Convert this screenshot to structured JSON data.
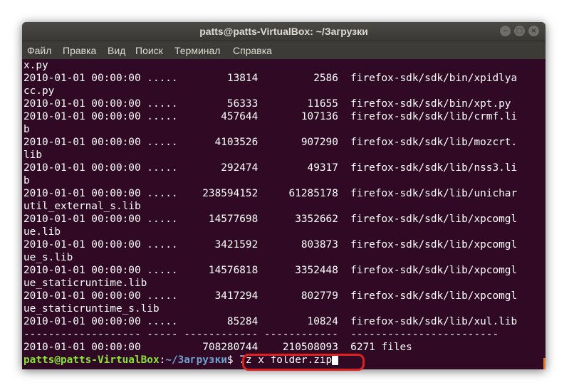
{
  "window": {
    "title": "patts@patts-VirtualBox: ~/Загрузки",
    "buttons": {
      "minimize": "–",
      "maximize": "□",
      "close": "×"
    }
  },
  "menu": [
    "Файл",
    "Правка",
    "Вид",
    "Поиск",
    "Терминал",
    "Справка"
  ],
  "terminal": {
    "lines": [
      "x.py",
      "2010-01-01 00:00:00 .....        13814         2586  firefox-sdk/sdk/bin/xpidlya",
      "cc.py",
      "2010-01-01 00:00:00 .....        56333        11655  firefox-sdk/sdk/bin/xpt.py",
      "2010-01-01 00:00:00 .....       457644       107136  firefox-sdk/sdk/lib/crmf.li",
      "b",
      "2010-01-01 00:00:00 .....      4103526       907290  firefox-sdk/sdk/lib/mozcrt.",
      "lib",
      "2010-01-01 00:00:00 .....       292474        49317  firefox-sdk/sdk/lib/nss3.li",
      "b",
      "2010-01-01 00:00:00 .....    238594152     61285178  firefox-sdk/sdk/lib/unichar",
      "util_external_s.lib",
      "2010-01-01 00:00:00 .....     14577698      3352662  firefox-sdk/sdk/lib/xpcomgl",
      "ue.lib",
      "2010-01-01 00:00:00 .....      3421592       803873  firefox-sdk/sdk/lib/xpcomgl",
      "ue_s.lib",
      "2010-01-01 00:00:00 .....     14576818      3352448  firefox-sdk/sdk/lib/xpcomgl",
      "ue_staticruntime.lib",
      "2010-01-01 00:00:00 .....      3417294       802779  firefox-sdk/sdk/lib/xpcomgl",
      "ue_staticruntime_s.lib",
      "2010-01-01 00:00:00 .....        85284        10824  firefox-sdk/sdk/lib/xul.lib",
      "------------------- ----- ------------ ------------  ------------------------",
      "2010-01-01 00:00:00          708280744    210508093  6271 files"
    ],
    "prompt": {
      "user_host": "patts@patts-VirtualBox",
      "sep": ":",
      "path": "~/Загрузки",
      "symbol": "$ ",
      "command": "7z x folder.zip"
    }
  },
  "colors": {
    "terminal_bg": "#300a24",
    "prompt_user": "#8ae234",
    "prompt_path": "#729fcf",
    "highlight": "#e02020",
    "scroll_thumb": "#e07b2a"
  }
}
